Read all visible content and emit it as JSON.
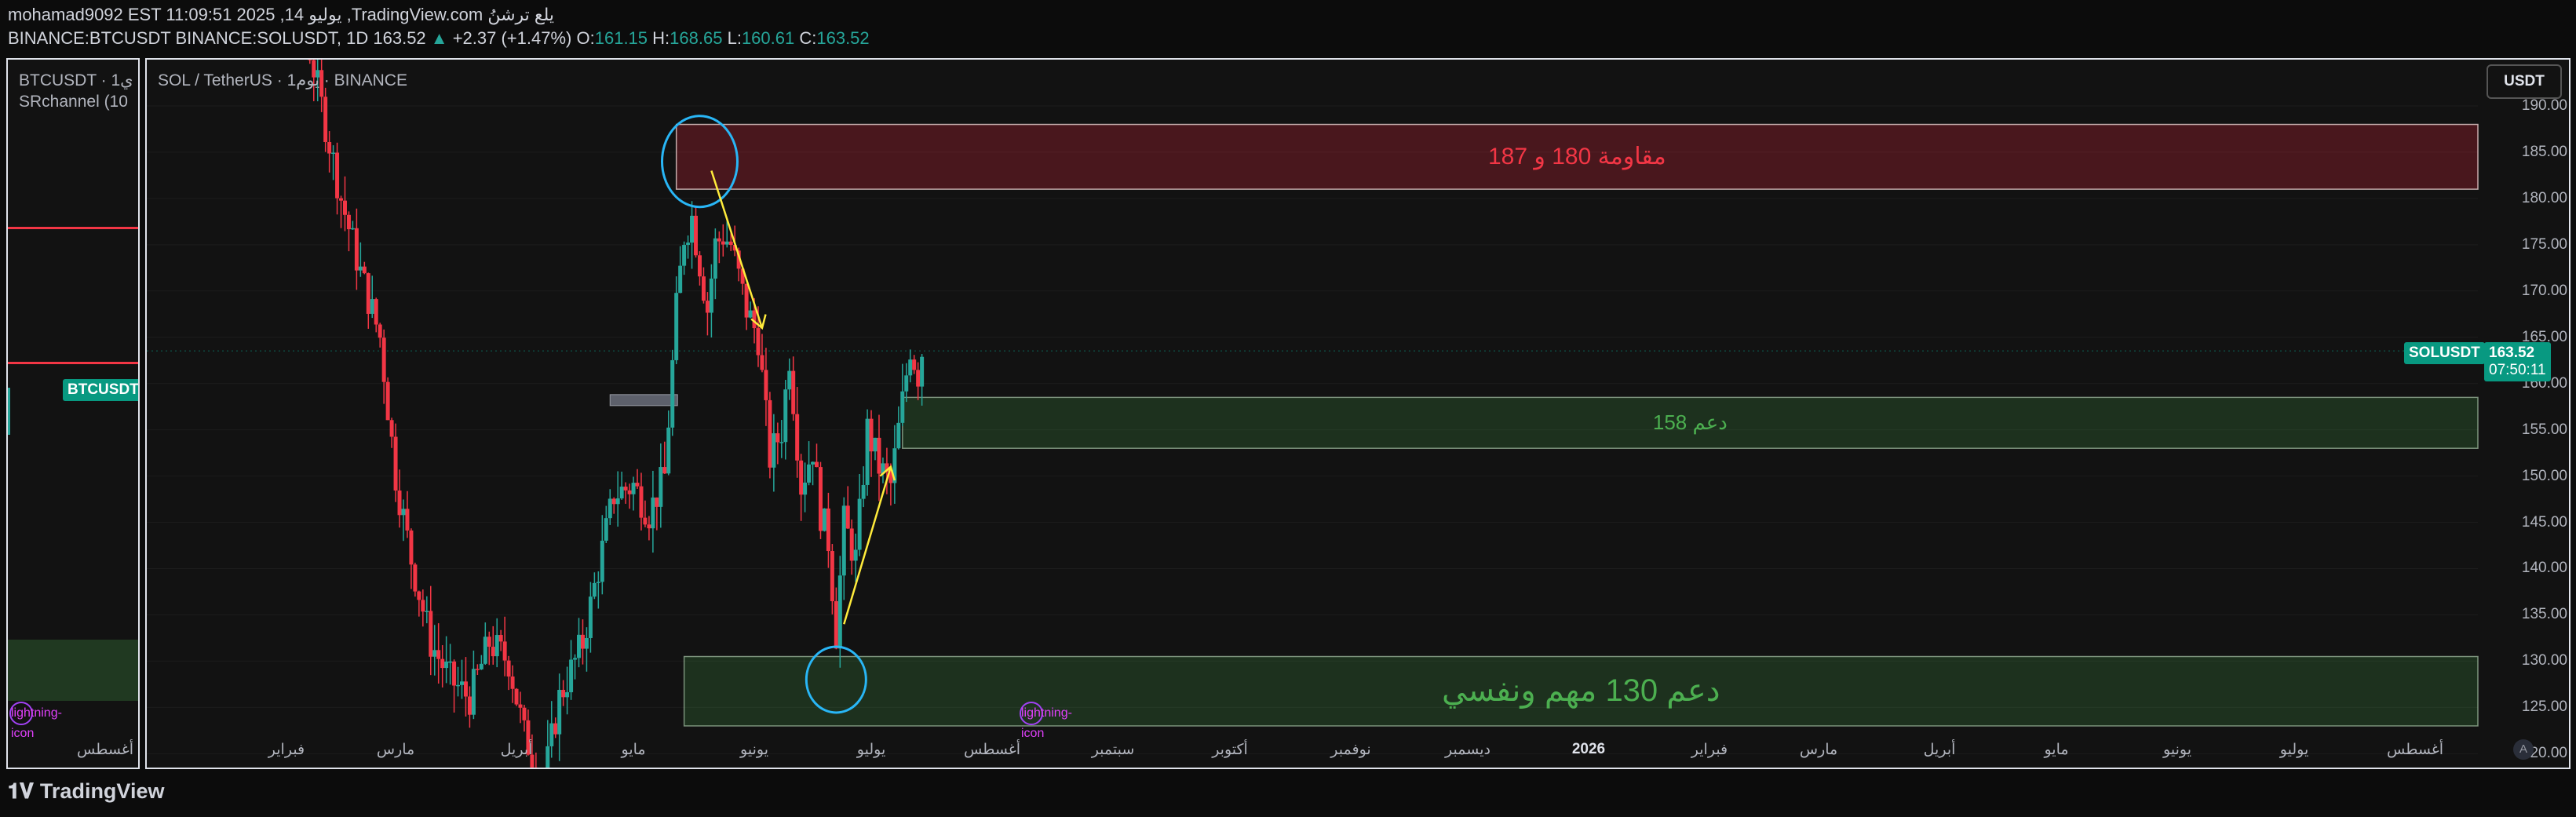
{
  "header": {
    "line1": "mohamad9092 EST 11:09:51 2025 ,يوليو 14 ,TradingView.com يلع ترشنُ",
    "pair_prefix": "BINANCE:BTCUSDT BINANCE:SOLUSDT, 1D",
    "last": "163.52",
    "change_arrow": "▲",
    "change": "+2.37 (+1.47%)",
    "o_label": "O:",
    "o_value": "161.15",
    "h_label": "H:",
    "h_value": "168.65",
    "l_label": "L:",
    "l_value": "160.61",
    "c_label": "C:",
    "c_value": "163.52"
  },
  "left_panel": {
    "symbol_line": "BTCUSDT · 1ي",
    "indicator": "SRchannel (10",
    "price_tag": "BTCUSDT",
    "x_label": "أغسطس",
    "bolt_icon": "lightning-icon"
  },
  "main_panel": {
    "symbol_line": "SOL / TetherUS · 1يوم · BINANCE",
    "unit_button": "USDT",
    "price_tag_symbol": "SOLUSDT",
    "price_tag_value": "163.52",
    "price_tag_timer": "07:50:11",
    "auto_button": "A",
    "bolt_icon": "lightning-icon"
  },
  "annotations": {
    "resistance": "مقاومة 180 و 187",
    "support_158": "دعم 158",
    "support_130": "دعم 130 مهم ونفسي"
  },
  "colors": {
    "up": "#26a69a",
    "down": "#f23645",
    "tag_bg": "#089981",
    "circle": "#29b6f6",
    "arrow": "#ffeb3b"
  },
  "chart_data": {
    "type": "candlestick",
    "symbol": "SOLUSDT",
    "timeframe": "1D",
    "y_ticks": [
      190,
      185,
      180,
      175,
      170,
      165,
      160,
      155,
      150,
      145,
      140,
      135,
      130,
      125,
      120
    ],
    "y_tick_labels": [
      "190.00",
      "185.00",
      "180.00",
      "175.00",
      "170.00",
      "165.00",
      "160.00",
      "155.00",
      "150.00",
      "145.00",
      "140.00",
      "135.00",
      "130.00",
      "125.00",
      "120.00"
    ],
    "ylim": [
      118.5,
      195
    ],
    "x_labels": [
      "فبراير",
      "مارس",
      "أبريل",
      "مايو",
      "يونيو",
      "يوليو",
      "أغسطس",
      "سبتمبر",
      "أكتوبر",
      "نوفمبر",
      "ديسمبر",
      "2026",
      "فبراير",
      "مارس",
      "أبريل",
      "مايو",
      "يونيو",
      "يوليو",
      "أغسطس"
    ],
    "zones": [
      {
        "name": "resistance",
        "low": 181,
        "high": 188
      },
      {
        "name": "support",
        "low": 153,
        "high": 158.5
      },
      {
        "name": "support",
        "low": 123,
        "high": 130.5
      }
    ],
    "close_path": [
      [
        "2025-01-15",
        200
      ],
      [
        "2025-01-25",
        205
      ],
      [
        "2025-02-01",
        225
      ],
      [
        "2025-02-05",
        200
      ],
      [
        "2025-02-10",
        190
      ],
      [
        "2025-02-15",
        180
      ],
      [
        "2025-02-20",
        172
      ],
      [
        "2025-02-25",
        165
      ],
      [
        "2025-03-01",
        150
      ],
      [
        "2025-03-05",
        141
      ],
      [
        "2025-03-10",
        132
      ],
      [
        "2025-03-15",
        128
      ],
      [
        "2025-03-20",
        126
      ],
      [
        "2025-03-25",
        132
      ],
      [
        "2025-03-30",
        130
      ],
      [
        "2025-04-03",
        122
      ],
      [
        "2025-04-08",
        117
      ],
      [
        "2025-04-12",
        126
      ],
      [
        "2025-04-18",
        132
      ],
      [
        "2025-04-22",
        140
      ],
      [
        "2025-04-26",
        148
      ],
      [
        "2025-05-01",
        149
      ],
      [
        "2025-05-05",
        146
      ],
      [
        "2025-05-09",
        150
      ],
      [
        "2025-05-12",
        168
      ],
      [
        "2025-05-14",
        176
      ],
      [
        "2025-05-16",
        178
      ],
      [
        "2025-05-18",
        173
      ],
      [
        "2025-05-20",
        168
      ],
      [
        "2025-05-22",
        175
      ],
      [
        "2025-05-24",
        176
      ],
      [
        "2025-05-26",
        175
      ],
      [
        "2025-05-30",
        168
      ],
      [
        "2025-06-02",
        165
      ],
      [
        "2025-06-05",
        152
      ],
      [
        "2025-06-08",
        155
      ],
      [
        "2025-06-10",
        163
      ],
      [
        "2025-06-13",
        149
      ],
      [
        "2025-06-16",
        153
      ],
      [
        "2025-06-18",
        146
      ],
      [
        "2025-06-20",
        143
      ],
      [
        "2025-06-22",
        133
      ],
      [
        "2025-06-24",
        145
      ],
      [
        "2025-06-27",
        141
      ],
      [
        "2025-06-30",
        155
      ],
      [
        "2025-07-03",
        151
      ],
      [
        "2025-07-06",
        149
      ],
      [
        "2025-07-09",
        158
      ],
      [
        "2025-07-11",
        164
      ],
      [
        "2025-07-13",
        161
      ],
      [
        "2025-07-14",
        163.52
      ]
    ],
    "last_price": 163.52,
    "markers": [
      {
        "type": "circle",
        "date": "2025-05-18",
        "price": 184
      },
      {
        "type": "circle",
        "date": "2025-06-22",
        "price": 128
      },
      {
        "type": "arrow",
        "from": [
          "2025-05-21",
          183
        ],
        "to": [
          "2025-06-03",
          166
        ]
      },
      {
        "type": "arrow",
        "from": [
          "2025-06-24",
          134
        ],
        "to": [
          "2025-07-06",
          151
        ]
      }
    ]
  }
}
